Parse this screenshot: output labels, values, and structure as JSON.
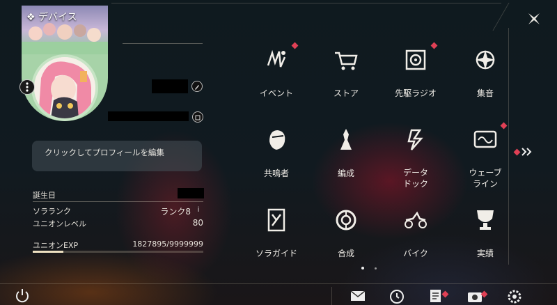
{
  "panel": {
    "title": "デバイス"
  },
  "profile": {
    "edit_prompt": "クリックしてプロフィールを編集",
    "stats": [
      {
        "label": "誕生日",
        "value": ""
      },
      {
        "label": "ソラランク",
        "value": "ランク8"
      },
      {
        "label": "ユニオンレベル",
        "value": "80"
      }
    ],
    "exp": {
      "label": "ユニオンEXP",
      "value": "1827895/9999999",
      "fraction": 0.18
    },
    "rank_info_icon": "i"
  },
  "menu": [
    {
      "label": "イベント",
      "icon": "event-icon",
      "badge": true
    },
    {
      "label": "ストア",
      "icon": "store-icon",
      "badge": false
    },
    {
      "label": "先駆ラジオ",
      "icon": "radio-icon",
      "badge": true
    },
    {
      "label": "集音",
      "icon": "echo-icon",
      "badge": false
    },
    {
      "label": "共鳴者",
      "icon": "resonator-icon",
      "badge": false
    },
    {
      "label": "編成",
      "icon": "team-icon",
      "badge": false
    },
    {
      "label": "データ\nドック",
      "icon": "data-dock-icon",
      "badge": false
    },
    {
      "label": "ウェーブ\nライン",
      "icon": "waveline-icon",
      "badge": true
    },
    {
      "label": "ソラガイド",
      "icon": "guide-icon",
      "badge": false
    },
    {
      "label": "合成",
      "icon": "synthesis-icon",
      "badge": false
    },
    {
      "label": "バイク",
      "icon": "bike-icon",
      "badge": false
    },
    {
      "label": "実績",
      "icon": "achievement-icon",
      "badge": false
    }
  ],
  "pager": {
    "current": 1,
    "total": 2
  },
  "colors": {
    "accent": "#efe1c2",
    "badge": "#e04055",
    "text": "#f1eee8"
  }
}
